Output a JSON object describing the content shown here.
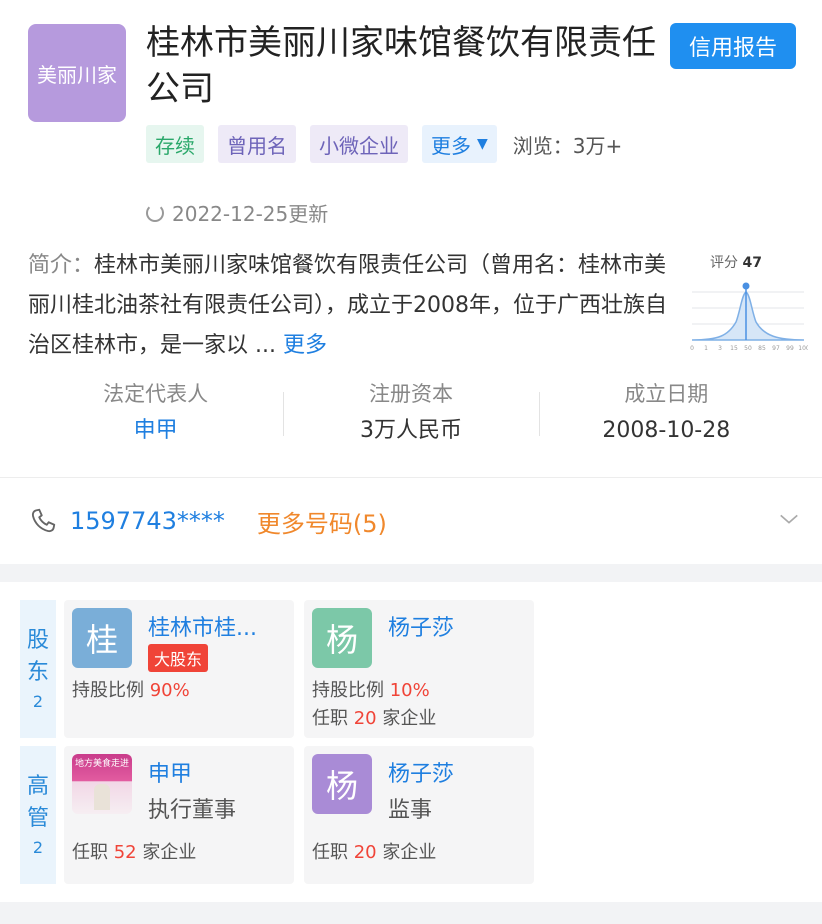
{
  "company": {
    "logo_text": "美丽川家",
    "name": "桂林市美丽川家味馆餐饮有限责任公司",
    "credit_report": "信用报告"
  },
  "tags": {
    "status": "存续",
    "former_name": "曾用名",
    "size": "小微企业",
    "more": "更多",
    "views": "浏览：3万+"
  },
  "update": "2022-12-25更新",
  "intro": {
    "label": "简介：",
    "text": "桂林市美丽川家味馆餐饮有限责任公司（曾用名：桂林市美丽川桂北油茶社有限责任公司），成立于2008年，位于广西壮族自治区桂林市，是一家以",
    "more": "更多"
  },
  "score": {
    "label": "评分",
    "value": "47",
    "ticks": [
      "0",
      "1",
      "3",
      "15",
      "50",
      "85",
      "97",
      "99",
      "100"
    ],
    "accent": "#4a90e2"
  },
  "stats": [
    {
      "label": "法定代表人",
      "value": "申甲"
    },
    {
      "label": "注册资本",
      "value": "3万人民币"
    },
    {
      "label": "成立日期",
      "value": "2008-10-28"
    }
  ],
  "phone": {
    "number": "1597743****",
    "more": "更多号码(5)"
  },
  "shareholders": {
    "tab_label": "股东",
    "count": "2",
    "items": [
      {
        "avatar": "桂",
        "name": "桂林市桂...",
        "badge": "大股东",
        "ratio_label": "持股比例",
        "ratio": "90%",
        "avatar_color": "#7aaed8"
      },
      {
        "avatar": "杨",
        "name": "杨子莎",
        "ratio_label": "持股比例",
        "ratio": "10%",
        "jobs_prefix": "任职",
        "jobs": "20",
        "jobs_suffix": "家企业",
        "avatar_color": "#7cc8a8"
      }
    ]
  },
  "executives": {
    "tab_label": "高管",
    "count": "2",
    "items": [
      {
        "name": "申甲",
        "role": "执行董事",
        "photo_text": "地方美食走进",
        "jobs_prefix": "任职",
        "jobs": "52",
        "jobs_suffix": "家企业"
      },
      {
        "avatar": "杨",
        "name": "杨子莎",
        "role": "监事",
        "jobs_prefix": "任职",
        "jobs": "20",
        "jobs_suffix": "家企业",
        "avatar_color": "#a98bd6"
      }
    ]
  }
}
